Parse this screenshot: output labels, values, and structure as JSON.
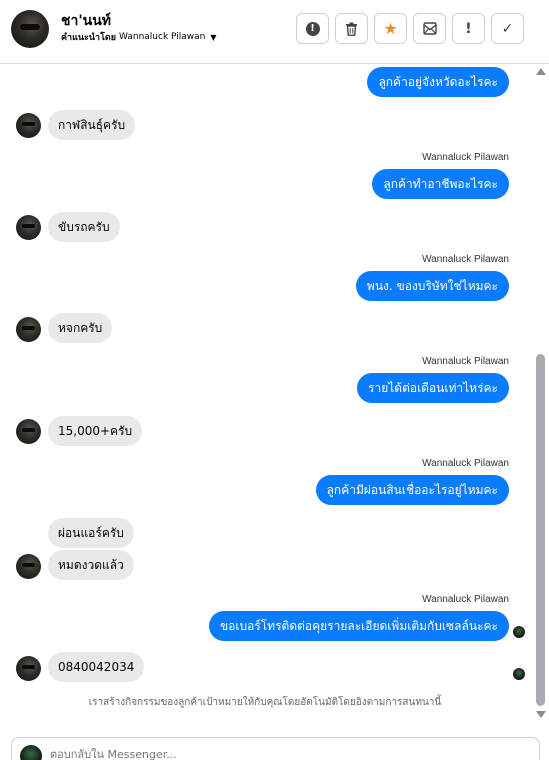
{
  "header": {
    "contact_name": "ชา'นนท์",
    "assign_label": "คำแนะนำโดย",
    "assignee": "Wannaluck Pilawan",
    "toolbar": [
      {
        "icon": "alert-circle-icon",
        "glyph": "!"
      },
      {
        "icon": "trash-icon",
        "glyph": "🗑"
      },
      {
        "icon": "star-icon",
        "glyph": "★"
      },
      {
        "icon": "archive-mail-icon",
        "glyph": "✉"
      },
      {
        "icon": "exclamation-icon",
        "glyph": "!"
      },
      {
        "icon": "checkmark-icon",
        "glyph": "✓"
      }
    ]
  },
  "messages": {
    "m0": "ลูกค้าอยู่จังหวัดอะไรคะ",
    "m1": "กาฬสินธุ์ครับ",
    "m2_sender": "Wannaluck Pilawan",
    "m2": "ลูกค้าทำอาชีพอะไรคะ",
    "m3": "ขับรถครับ",
    "m4_sender": "Wannaluck Pilawan",
    "m4": "พนง.  ของบริษัทใช่ไหมคะ",
    "m5": "หจกครับ",
    "m6_sender": "Wannaluck Pilawan",
    "m6": "รายได้ต่อเดือนเท่าไหร่คะ",
    "m7": "15,000+ครับ",
    "m8_sender": "Wannaluck Pilawan",
    "m8": "ลูกค้ามีผ่อนสินเชื่ออะไรอยู่ไหมคะ",
    "m9a": "ผ่อนแอร์ครับ",
    "m9b": "หมดงวดแล้ว",
    "m10_sender": "Wannaluck Pilawan",
    "m10": "ขอเบอร์โทรติดต่อคุยรายละเอียดเพิ่มเติมกับเซลล์นะคะ",
    "m11": "0840042034"
  },
  "footer_note": "เราสร้างกิจกรรมของลูกค้าเป้าหมายให้กับคุณโดยอัตโนมัติโดยอิงตามการสนทนานี้",
  "composer": {
    "placeholder": "ตอบกลับใน Messenger..."
  },
  "colors": {
    "outgoing_bubble": "#0a7cff",
    "incoming_bubble": "#e9e9eb",
    "star": "#f08a24"
  }
}
